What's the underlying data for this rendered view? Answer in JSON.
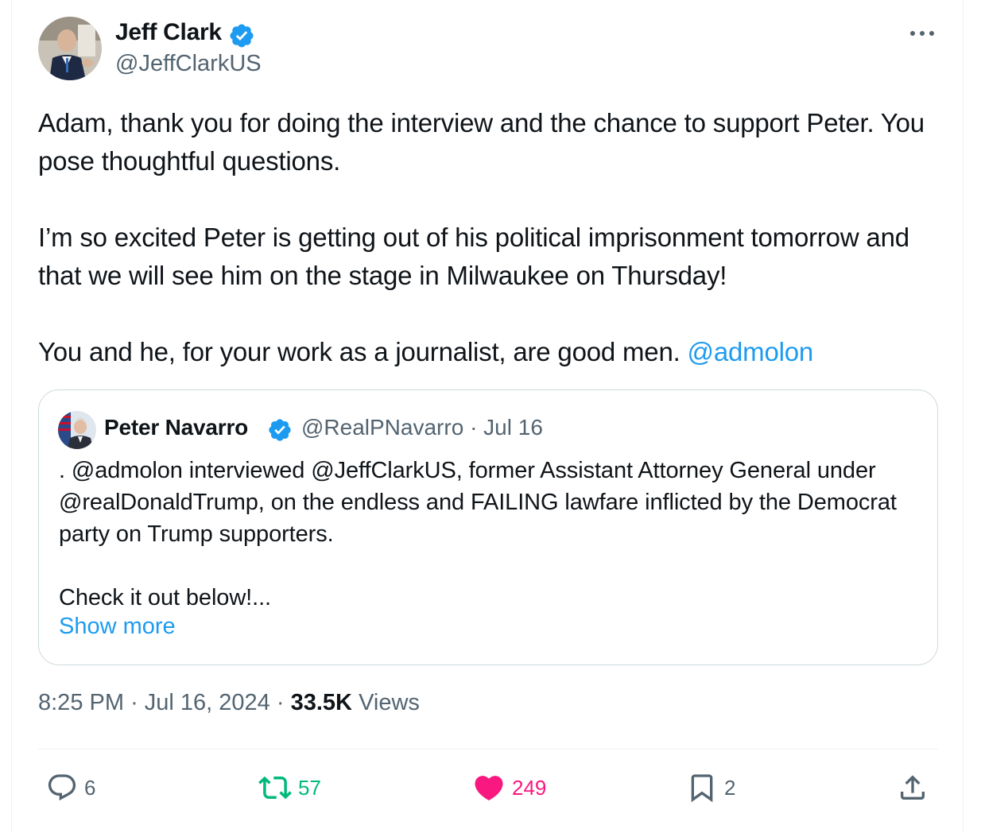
{
  "tweet": {
    "author": {
      "name": "Jeff Clark",
      "handle": "@JeffClarkUS",
      "verified": true
    },
    "paragraphs": [
      "Adam, thank you for doing the interview and the chance to support Peter. You pose thoughtful questions.",
      "I’m so excited Peter is getting out of his political imprisonment tomorrow and that we will see him on the stage in Milwaukee on Thursday!",
      "You and he, for your work as a journalist, are good men."
    ],
    "mention": "@admolon",
    "time": "8:25 PM",
    "date": "Jul 16, 2024",
    "views_count": "33.5K",
    "views_label": "Views",
    "separator": "·"
  },
  "quote": {
    "author": {
      "name": "Peter Navarro",
      "handle": "@RealPNavarro",
      "verified": true
    },
    "date": "Jul 16",
    "line1": ". @admolon interviewed @JeffClarkUS, former Assistant Attorney General under @realDonaldTrump, on the endless and FAILING lawfare inflicted by the Democrat party on Trump supporters.",
    "line2": "Check it out below!...",
    "show_more": "Show more"
  },
  "actions": {
    "replies": "6",
    "retweets": "57",
    "likes": "249",
    "bookmarks": "2"
  },
  "colors": {
    "link": "#1d9bf0",
    "retweet": "#00ba7c",
    "like": "#f91880",
    "secondary_text": "#536471",
    "verified": "#1d9bf0"
  },
  "icons": {
    "more": "more-horizontal-icon",
    "reply": "reply-icon",
    "retweet": "retweet-icon",
    "like": "heart-filled-icon",
    "bookmark": "bookmark-icon",
    "share": "share-icon",
    "verified": "verified-badge-icon"
  }
}
